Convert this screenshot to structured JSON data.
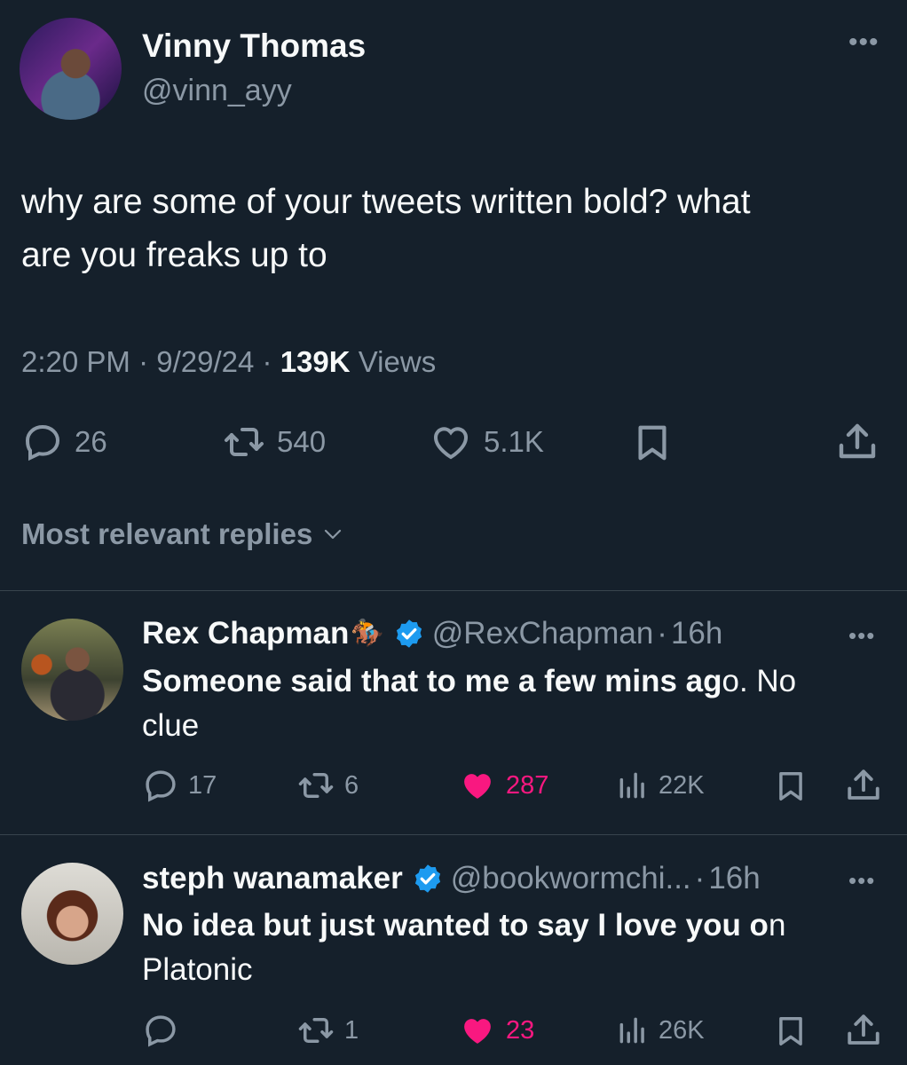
{
  "main_tweet": {
    "name": "Vinny Thomas",
    "handle": "@vinn_ayy",
    "text_line1": "why are some of your tweets written bold? what",
    "text_line2": "are you freaks up to",
    "time": "2:20 PM",
    "date": "9/29/24",
    "views_count": "139K",
    "views_label": "Views",
    "separator": "·",
    "stats": {
      "replies": "26",
      "reposts": "540",
      "likes": "5.1K"
    }
  },
  "replies_filter": {
    "label": "Most relevant replies"
  },
  "replies": [
    {
      "name": "Rex Chapman",
      "emoji": "🏇",
      "handle": "@RexChapman",
      "time": "16h",
      "separator": "·",
      "text_bold": "Someone said that to me a few mins ag",
      "text_rest": "o. No",
      "text_line2": "clue",
      "stats": {
        "replies": "17",
        "reposts": "6",
        "likes": "287",
        "views": "22K"
      }
    },
    {
      "name": "steph wanamaker",
      "handle": "@bookwormchi...",
      "time": "16h",
      "separator": "·",
      "text_bold": "No idea but just wanted to say I love you o",
      "text_rest": "n",
      "text_line2": "Platonic",
      "stats": {
        "replies": "",
        "reposts": "1",
        "likes": "23",
        "views": "26K"
      }
    }
  ],
  "colors": {
    "background": "#15202b",
    "muted": "#8b98a5",
    "text": "#f7f9f9",
    "like": "#f91880",
    "verified": "#1d9bf0",
    "divider": "#38444d"
  },
  "icons": [
    "more-icon",
    "reply-icon",
    "repost-icon",
    "like-icon",
    "bookmark-icon",
    "share-icon",
    "views-icon",
    "verified-icon",
    "chevron-down-icon"
  ]
}
